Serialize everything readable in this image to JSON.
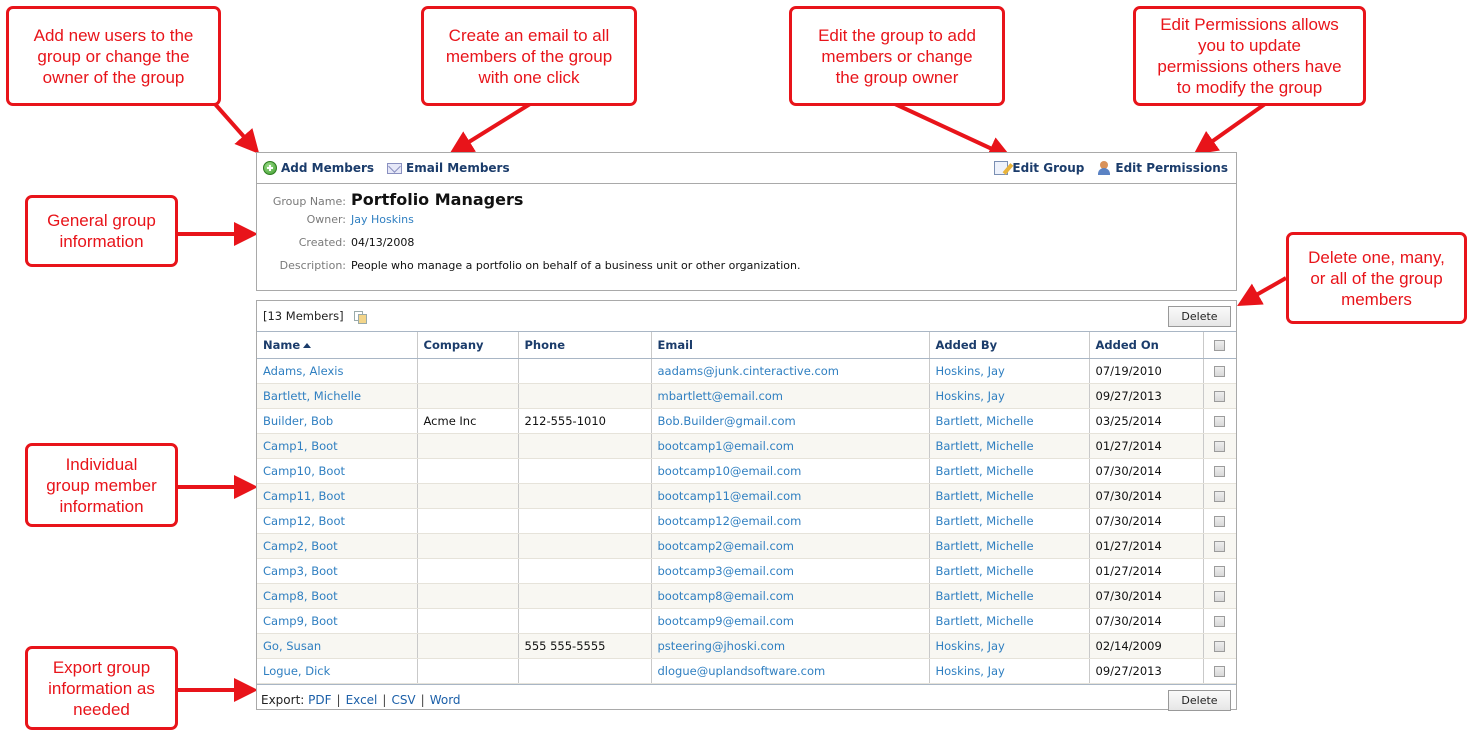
{
  "callouts": {
    "add_members": [
      "Add new users to the",
      "group or change the",
      "owner of the group"
    ],
    "email_members": [
      "Create an email to all",
      "members of the group",
      "with one click"
    ],
    "edit_group": [
      "Edit the group to add",
      "members or change",
      "the group owner"
    ],
    "edit_permissions": [
      "Edit Permissions allows",
      "you to update",
      "permissions others have",
      "to modify the group"
    ],
    "general_info": [
      "General group",
      "information"
    ],
    "delete_members": [
      "Delete one, many,",
      "or all of the group",
      "members"
    ],
    "member_info": [
      "Individual",
      "group member",
      "information"
    ],
    "export_info": [
      "Export group",
      "information as",
      "needed"
    ]
  },
  "toolbar": {
    "add_members": "Add Members",
    "email_members": "Email Members",
    "edit_group": "Edit Group",
    "edit_permissions": "Edit Permissions"
  },
  "group": {
    "name_label": "Group Name:",
    "name": "Portfolio Managers",
    "owner_label": "Owner:",
    "owner": "Jay Hoskins",
    "created_label": "Created:",
    "created": "04/13/2008",
    "description_label": "Description:",
    "description": "People who manage a portfolio on behalf of a business unit or other organization."
  },
  "members": {
    "count_label": "[13 Members]",
    "delete_label": "Delete",
    "columns": [
      "Name",
      "Company",
      "Phone",
      "Email",
      "Added By",
      "Added On"
    ],
    "sorted_column": "Name",
    "rows": [
      {
        "name": "Adams, Alexis",
        "company": "",
        "phone": "",
        "email": "aadams@junk.cinteractive.com",
        "added_by": "Hoskins, Jay",
        "added_on": "07/19/2010"
      },
      {
        "name": "Bartlett, Michelle",
        "company": "",
        "phone": "",
        "email": "mbartlett@email.com",
        "added_by": "Hoskins, Jay",
        "added_on": "09/27/2013"
      },
      {
        "name": "Builder, Bob",
        "company": "Acme Inc",
        "phone": "212-555-1010",
        "email": "Bob.Builder@gmail.com",
        "added_by": "Bartlett, Michelle",
        "added_on": "03/25/2014"
      },
      {
        "name": "Camp1, Boot",
        "company": "",
        "phone": "",
        "email": "bootcamp1@email.com",
        "added_by": "Bartlett, Michelle",
        "added_on": "01/27/2014"
      },
      {
        "name": "Camp10, Boot",
        "company": "",
        "phone": "",
        "email": "bootcamp10@email.com",
        "added_by": "Bartlett, Michelle",
        "added_on": "07/30/2014"
      },
      {
        "name": "Camp11, Boot",
        "company": "",
        "phone": "",
        "email": "bootcamp11@email.com",
        "added_by": "Bartlett, Michelle",
        "added_on": "07/30/2014"
      },
      {
        "name": "Camp12, Boot",
        "company": "",
        "phone": "",
        "email": "bootcamp12@email.com",
        "added_by": "Bartlett, Michelle",
        "added_on": "07/30/2014"
      },
      {
        "name": "Camp2, Boot",
        "company": "",
        "phone": "",
        "email": "bootcamp2@email.com",
        "added_by": "Bartlett, Michelle",
        "added_on": "01/27/2014"
      },
      {
        "name": "Camp3, Boot",
        "company": "",
        "phone": "",
        "email": "bootcamp3@email.com",
        "added_by": "Bartlett, Michelle",
        "added_on": "01/27/2014"
      },
      {
        "name": "Camp8, Boot",
        "company": "",
        "phone": "",
        "email": "bootcamp8@email.com",
        "added_by": "Bartlett, Michelle",
        "added_on": "07/30/2014"
      },
      {
        "name": "Camp9, Boot",
        "company": "",
        "phone": "",
        "email": "bootcamp9@email.com",
        "added_by": "Bartlett, Michelle",
        "added_on": "07/30/2014"
      },
      {
        "name": "Go, Susan",
        "company": "",
        "phone": "555 555-5555",
        "email": "psteering@jhoski.com",
        "added_by": "Hoskins, Jay",
        "added_on": "02/14/2009"
      },
      {
        "name": "Logue, Dick",
        "company": "",
        "phone": "",
        "email": "dlogue@uplandsoftware.com",
        "added_by": "Hoskins, Jay",
        "added_on": "09/27/2013"
      }
    ]
  },
  "export": {
    "label": "Export:",
    "formats": [
      "PDF",
      "Excel",
      "CSV",
      "Word"
    ]
  },
  "icons": {
    "add_members": "add-circle-icon",
    "email_members": "envelope-icon",
    "edit_group": "edit-document-icon",
    "edit_permissions": "user-permissions-icon",
    "copy": "copy-icon"
  },
  "colors": {
    "callout": "#e8141a",
    "link": "#2f7fc1",
    "header_text": "#1b3c6b"
  }
}
